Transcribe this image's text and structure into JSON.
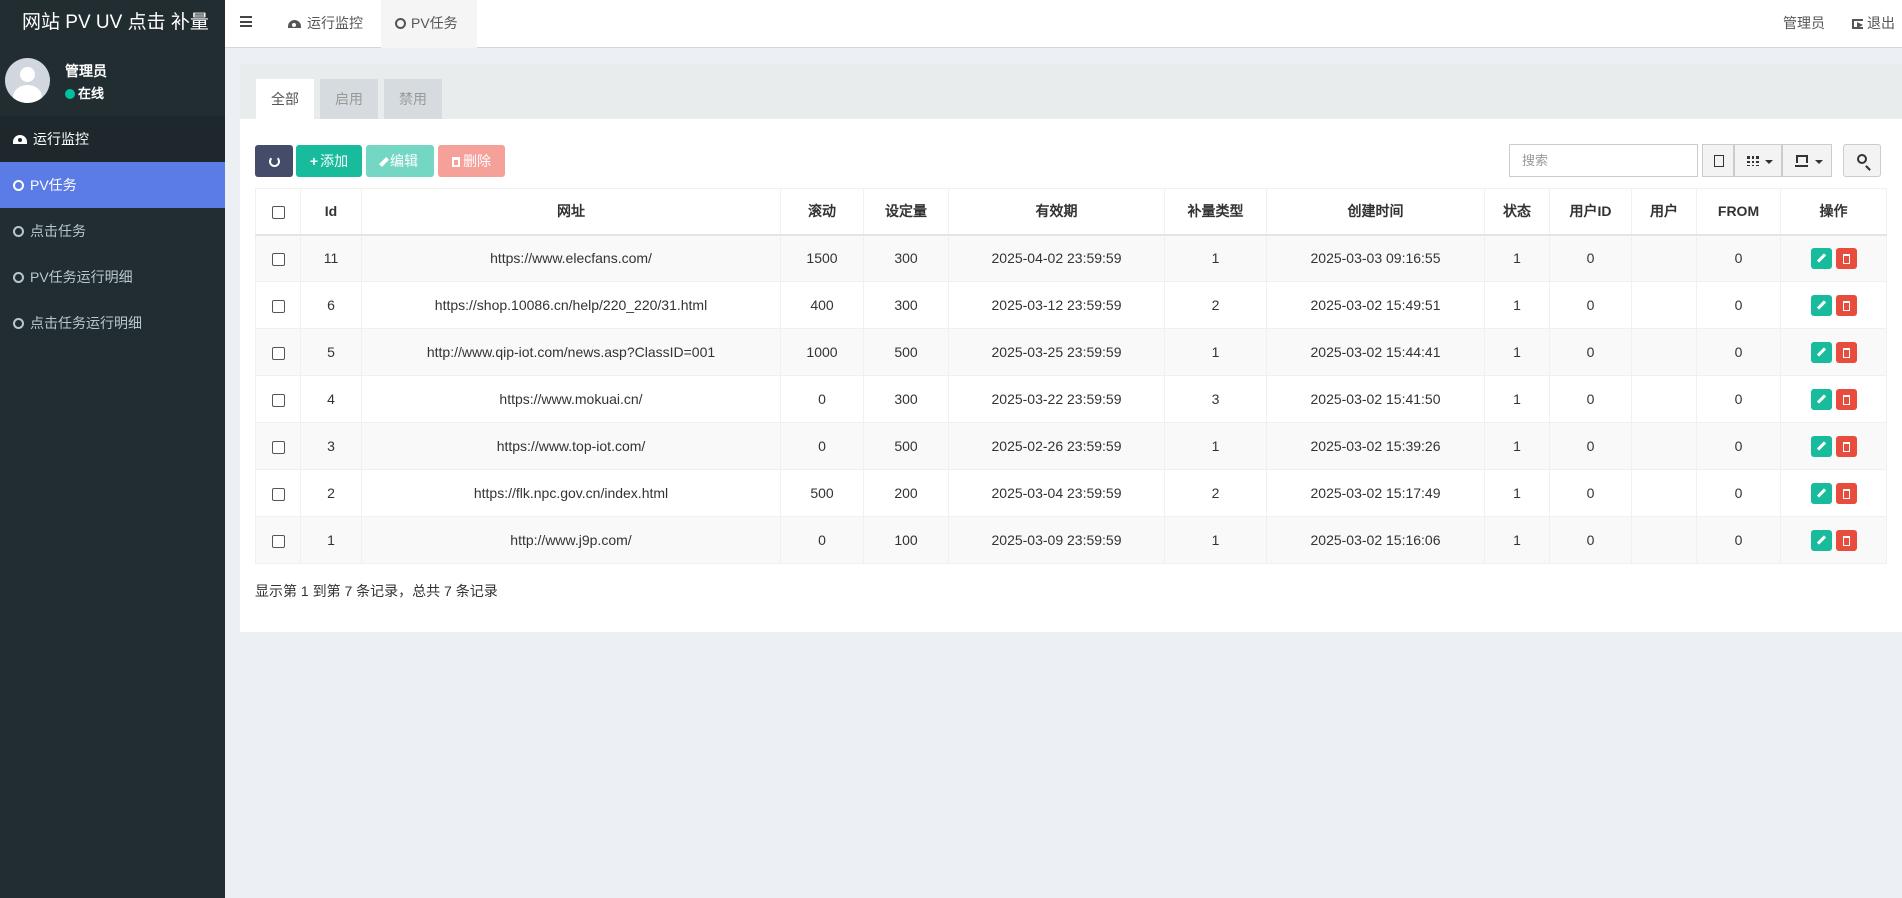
{
  "app": {
    "brand": "网站 PV UV 点击 补量"
  },
  "user": {
    "name": "管理员",
    "status": "在线"
  },
  "sidebar": {
    "items": [
      {
        "label": "运行监控"
      },
      {
        "label": "PV任务"
      },
      {
        "label": "点击任务"
      },
      {
        "label": "PV任务运行明细"
      },
      {
        "label": "点击任务运行明细"
      }
    ]
  },
  "header": {
    "tabs": [
      {
        "label": "运行监控"
      },
      {
        "label": "PV任务"
      }
    ],
    "admin_label": "管理员",
    "logout_label": "退出"
  },
  "filter_tabs": [
    {
      "label": "全部"
    },
    {
      "label": "启用"
    },
    {
      "label": "禁用"
    }
  ],
  "toolbar": {
    "add_label": "添加",
    "edit_label": "编辑",
    "delete_label": "删除",
    "search_placeholder": "搜索"
  },
  "table": {
    "columns": [
      "Id",
      "网址",
      "滚动",
      "设定量",
      "有效期",
      "补量类型",
      "创建时间",
      "状态",
      "用户ID",
      "用户",
      "FROM",
      "操作"
    ],
    "rows": [
      {
        "id": "11",
        "url": "https://www.elecfans.com/",
        "scroll": "1500",
        "amount": "300",
        "expire": "2025-04-02 23:59:59",
        "type": "1",
        "created": "2025-03-03 09:16:55",
        "status": "1",
        "uid": "0",
        "user": "",
        "from": "0"
      },
      {
        "id": "6",
        "url": "https://shop.10086.cn/help/220_220/31.html",
        "scroll": "400",
        "amount": "300",
        "expire": "2025-03-12 23:59:59",
        "type": "2",
        "created": "2025-03-02 15:49:51",
        "status": "1",
        "uid": "0",
        "user": "",
        "from": "0"
      },
      {
        "id": "5",
        "url": "http://www.qip-iot.com/news.asp?ClassID=001",
        "scroll": "1000",
        "amount": "500",
        "expire": "2025-03-25 23:59:59",
        "type": "1",
        "created": "2025-03-02 15:44:41",
        "status": "1",
        "uid": "0",
        "user": "",
        "from": "0"
      },
      {
        "id": "4",
        "url": "https://www.mokuai.cn/",
        "scroll": "0",
        "amount": "300",
        "expire": "2025-03-22 23:59:59",
        "type": "3",
        "created": "2025-03-02 15:41:50",
        "status": "1",
        "uid": "0",
        "user": "",
        "from": "0"
      },
      {
        "id": "3",
        "url": "https://www.top-iot.com/",
        "scroll": "0",
        "amount": "500",
        "expire": "2025-02-26 23:59:59",
        "type": "1",
        "created": "2025-03-02 15:39:26",
        "status": "1",
        "uid": "0",
        "user": "",
        "from": "0"
      },
      {
        "id": "2",
        "url": "https://flk.npc.gov.cn/index.html",
        "scroll": "500",
        "amount": "200",
        "expire": "2025-03-04 23:59:59",
        "type": "2",
        "created": "2025-03-02 15:17:49",
        "status": "1",
        "uid": "0",
        "user": "",
        "from": "0"
      },
      {
        "id": "1",
        "url": "http://www.j9p.com/",
        "scroll": "0",
        "amount": "100",
        "expire": "2025-03-09 23:59:59",
        "type": "1",
        "created": "2025-03-02 15:16:06",
        "status": "1",
        "uid": "0",
        "user": "",
        "from": "0"
      }
    ]
  },
  "pagination": {
    "info": "显示第 1 到第 7 条记录，总共 7 条记录"
  },
  "colors": {
    "sidebar_bg": "#222d32",
    "sidebar_active": "#5b7be6",
    "add_green": "#18bc9c",
    "delete_red": "#e74c3c",
    "refresh_navy": "#444c69"
  }
}
